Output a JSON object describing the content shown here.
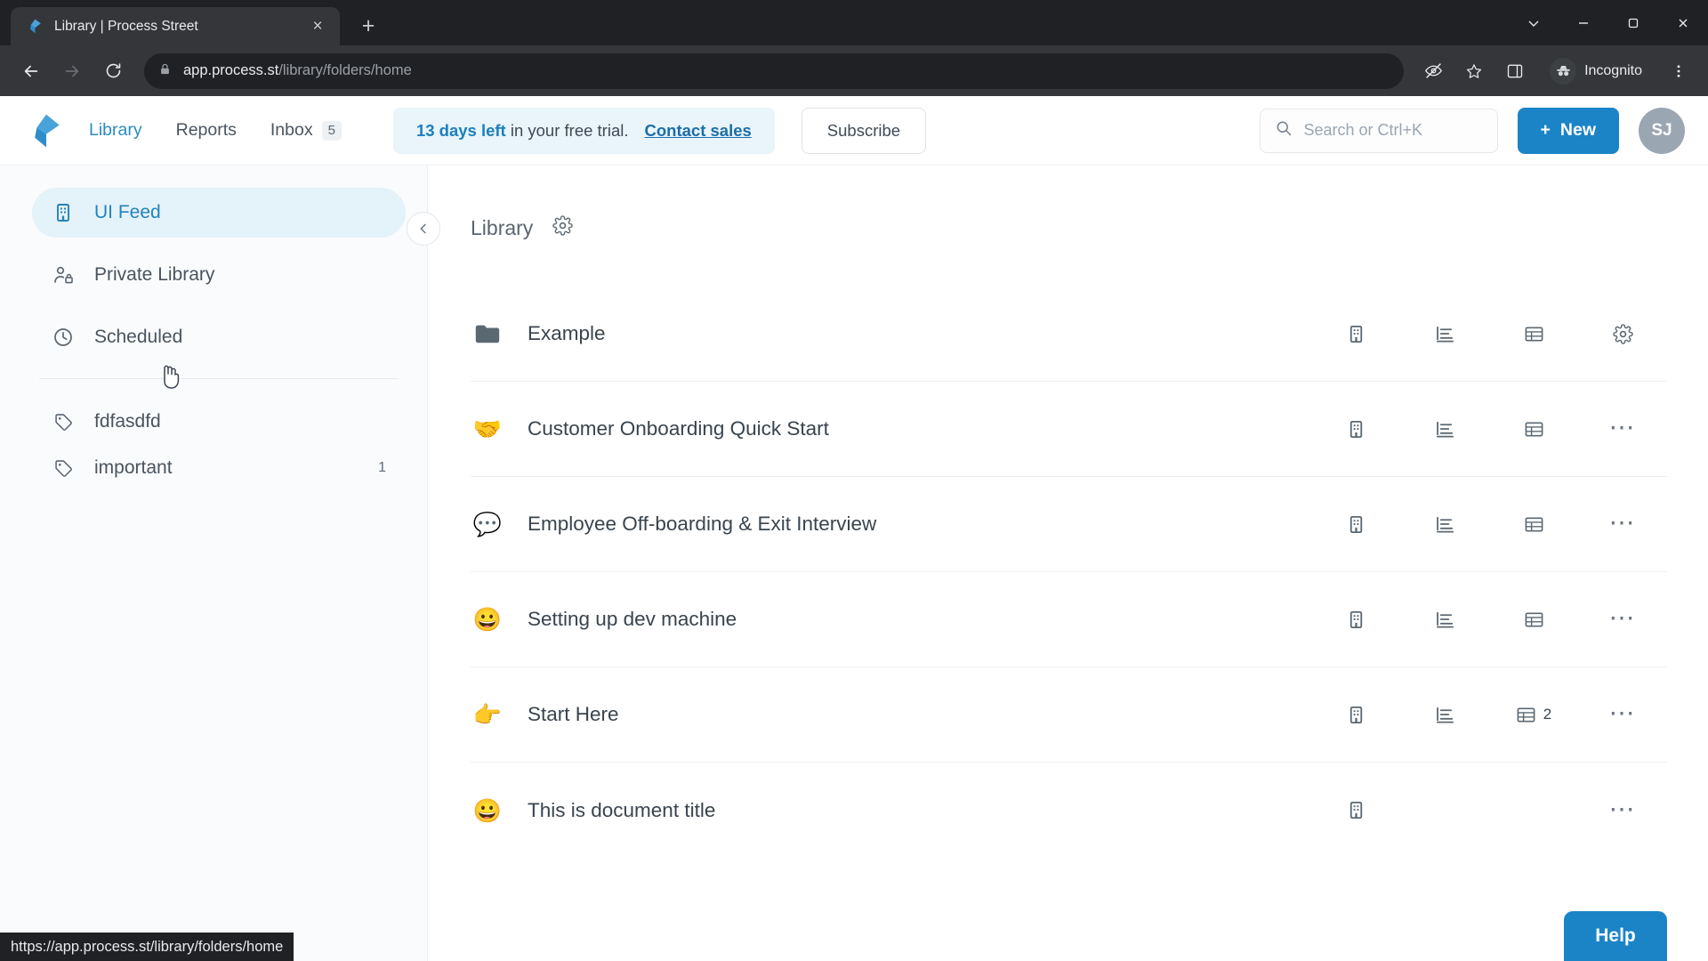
{
  "browser": {
    "tab": {
      "title": "Library | Process Street",
      "favicon": "process-street-logo",
      "close_label": "×"
    },
    "new_tab_label": "+",
    "window_controls": [
      {
        "name": "minimize-to-tray",
        "glyph": "⌄"
      },
      {
        "name": "minimize",
        "glyph": "−"
      },
      {
        "name": "maximize",
        "glyph": "❐"
      },
      {
        "name": "close",
        "glyph": "✕"
      }
    ],
    "nav": {
      "back": "←",
      "forward": "→",
      "reload": "↻"
    },
    "omnibox": {
      "lock_icon": "lock-icon",
      "url_domain": "app.process.st",
      "url_path": "/library/folders/home"
    },
    "omni_actions": {
      "tracking_protection": "eye-off-icon",
      "bookmark": "star-icon",
      "side_panel": "side-panel-icon",
      "menu": "kebab-menu-icon"
    },
    "incognito_label": "Incognito"
  },
  "status_bar": {
    "url": "https://app.process.st/library/folders/home"
  },
  "app_header": {
    "brand": "process-street-logo",
    "nav": [
      {
        "label": "Library",
        "active": true,
        "badge": null
      },
      {
        "label": "Reports",
        "active": false,
        "badge": null
      },
      {
        "label": "Inbox",
        "active": false,
        "badge": "5"
      }
    ],
    "trial": {
      "highlight": "13 days left",
      "rest": " in your free trial.",
      "link": "Contact sales"
    },
    "subscribe_label": "Subscribe",
    "search_placeholder": "Search or Ctrl+K",
    "new_label": "New",
    "new_plus": "+",
    "avatar_initials": "SJ"
  },
  "sidebar": {
    "items": [
      {
        "label": "UI Feed",
        "icon": "building-icon",
        "active": true
      },
      {
        "label": "Private Library",
        "icon": "user-lock-icon",
        "active": false
      },
      {
        "label": "Scheduled",
        "icon": "clock-icon",
        "active": false
      }
    ],
    "tags": [
      {
        "label": "fdfasdfd",
        "icon": "tag-icon",
        "count": null
      },
      {
        "label": "important",
        "icon": "tag-icon",
        "count": "1"
      }
    ]
  },
  "main": {
    "collapse_icon": "chevron-left-icon",
    "title": "Library",
    "settings_icon": "gear-icon",
    "rows": [
      {
        "name": "Example",
        "icon_type": "folder",
        "emoji": "",
        "actions": [
          {
            "name": "building-icon",
            "count": null
          },
          {
            "name": "report-icon",
            "count": null
          },
          {
            "name": "table-icon",
            "count": null
          },
          {
            "name": "gear-icon",
            "count": null
          }
        ]
      },
      {
        "name": "Customer Onboarding Quick Start",
        "icon_type": "emoji",
        "emoji": "🤝",
        "actions": [
          {
            "name": "building-icon",
            "count": null
          },
          {
            "name": "report-icon",
            "count": null
          },
          {
            "name": "table-icon",
            "count": null
          },
          {
            "name": "more-icon",
            "count": null
          }
        ]
      },
      {
        "name": "Employee Off-boarding & Exit Interview",
        "icon_type": "emoji",
        "emoji": "💬",
        "actions": [
          {
            "name": "building-icon",
            "count": null
          },
          {
            "name": "report-icon",
            "count": null
          },
          {
            "name": "table-icon",
            "count": null
          },
          {
            "name": "more-icon",
            "count": null
          }
        ]
      },
      {
        "name": "Setting up dev machine",
        "icon_type": "emoji",
        "emoji": "😀",
        "actions": [
          {
            "name": "building-icon",
            "count": null
          },
          {
            "name": "report-icon",
            "count": null
          },
          {
            "name": "table-icon",
            "count": null
          },
          {
            "name": "more-icon",
            "count": null
          }
        ]
      },
      {
        "name": "Start Here",
        "icon_type": "emoji",
        "emoji": "👉",
        "actions": [
          {
            "name": "building-icon",
            "count": null
          },
          {
            "name": "report-icon",
            "count": null
          },
          {
            "name": "table-icon",
            "count": "2"
          },
          {
            "name": "more-icon",
            "count": null
          }
        ]
      },
      {
        "name": "This is document title",
        "icon_type": "emoji",
        "emoji": "😀",
        "actions": [
          {
            "name": "building-icon",
            "count": null
          },
          {
            "name": "empty",
            "count": null
          },
          {
            "name": "empty",
            "count": null
          },
          {
            "name": "more-icon",
            "count": null
          }
        ]
      }
    ]
  },
  "help": {
    "label": "Help"
  },
  "colors": {
    "accent": "#1b84c7",
    "trial_banner_bg": "#e9f4fb",
    "sidebar_active_bg": "#e4f2fa",
    "sidebar_active_text": "#2483bb",
    "chrome_dark": "#202124",
    "chrome_toolbar": "#35363a"
  }
}
